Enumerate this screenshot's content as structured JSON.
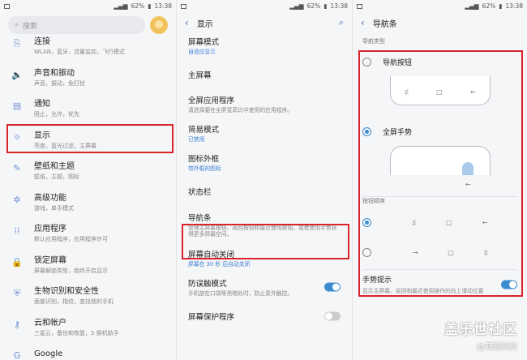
{
  "status": {
    "battery": "62%",
    "time": "13:38"
  },
  "settings": {
    "search_placeholder": "搜索",
    "items": [
      {
        "title": "连接",
        "sub": "WLAN，蓝牙，流量监控，飞行模式",
        "icon": "link-icon"
      },
      {
        "title": "声音和振动",
        "sub": "声音，振动，免打扰",
        "icon": "speaker-icon"
      },
      {
        "title": "通知",
        "sub": "阻止，允许，优先",
        "icon": "bell-icon"
      },
      {
        "title": "显示",
        "sub": "亮度，蓝光过滤，主屏幕",
        "icon": "display-icon"
      },
      {
        "title": "壁纸和主题",
        "sub": "壁纸，主题，图标",
        "icon": "brush-icon"
      },
      {
        "title": "高级功能",
        "sub": "游戏，单手模式",
        "icon": "gear-plus-icon"
      },
      {
        "title": "应用程序",
        "sub": "默认应用程序，应用程序许可",
        "icon": "apps-icon"
      },
      {
        "title": "锁定屏幕",
        "sub": "屏幕解锁类型，始终开启显示",
        "icon": "lock-icon"
      },
      {
        "title": "生物识别和安全性",
        "sub": "面部识别，指纹，查找我的手机",
        "icon": "shield-icon"
      },
      {
        "title": "云和帐户",
        "sub": "三星云，备份和恢复，S 换机助手",
        "icon": "key-icon"
      },
      {
        "title": "Google",
        "sub": "Google 设置",
        "icon": "google-icon"
      }
    ]
  },
  "display": {
    "title": "显示",
    "items": [
      {
        "title": "屏幕模式",
        "sub": "自适应显示",
        "sub_color": "blue",
        "toggle": null
      },
      {
        "title": "主屏幕",
        "sub": "",
        "sub_color": "grey",
        "toggle": null
      },
      {
        "title": "全屏应用程序",
        "sub": "请选择要在全屏宽高比中使用的应用程序。",
        "sub_color": "grey",
        "toggle": null
      },
      {
        "title": "简易模式",
        "sub": "已禁用",
        "sub_color": "blue",
        "toggle": null
      },
      {
        "title": "图标外框",
        "sub": "带外框的图标",
        "sub_color": "blue",
        "toggle": null
      },
      {
        "title": "状态栏",
        "sub": "",
        "sub_color": "grey",
        "toggle": null
      },
      {
        "title": "导航条",
        "sub": "管理主屏幕按钮、返回按钮和最近使用按钮，或者使用手势获得更多屏幕空间。",
        "sub_color": "grey",
        "toggle": null
      },
      {
        "title": "屏幕自动关闭",
        "sub": "屏幕在 30 秒 后自动关闭",
        "sub_color": "blue",
        "toggle": null
      },
      {
        "title": "防误触模式",
        "sub": "手机放在口袋等黑暗处时，防止意外触控。",
        "sub_color": "grey",
        "toggle": "on"
      },
      {
        "title": "屏幕保护程序",
        "sub": "",
        "sub_color": "grey",
        "toggle": "off"
      }
    ]
  },
  "navbar": {
    "title": "导航条",
    "section_type": "导航类型",
    "option_buttons": "导航按钮",
    "option_gestures": "全屏手势",
    "section_order": "按钮顺序",
    "gesture_hint_title": "手势提示",
    "gesture_hint_sub": "显示主屏幕、返回和最近使用操作的向上滑动位置",
    "nav_glyphs": {
      "recent": "⥶",
      "home": "□",
      "back": "←"
    }
  },
  "watermark": {
    "line1": "盖乐世社区",
    "line2": "@萌面狗狗"
  },
  "colors": {
    "accent": "#3b8dd0",
    "highlight": "#d9252a"
  }
}
